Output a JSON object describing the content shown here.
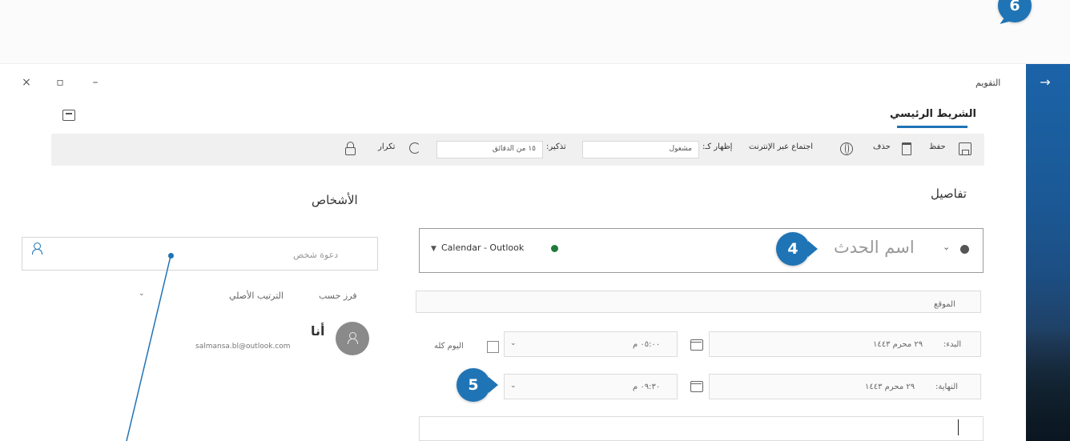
{
  "callouts": {
    "c4": "4",
    "c5": "5",
    "c6": "6"
  },
  "titlebar": {
    "app_label": "التقويم",
    "close": "×",
    "restore": "▫",
    "minimize": "–"
  },
  "ribbon": {
    "tab_home": "الشريط الرئيسي",
    "save": "حفظ",
    "delete": "حذف",
    "online_meeting": "اجتماع عبر الإنترنت",
    "show_as_label": "إظهار كـ:",
    "show_as_value": "مشغول",
    "reminder_label": "تذكير:",
    "reminder_value": "١٥ من الدقائق",
    "repeat": "تكرار"
  },
  "details": {
    "title": "تفاصيل",
    "event_name_placeholder": "اسم الحدث",
    "calendar": "Calendar - Outlook",
    "location_placeholder": "الموقع",
    "start_label": "البدء:",
    "start_date": "٢٩ محرم ١٤٤٣",
    "start_time": "٠٥:٠٠ م",
    "all_day": "اليوم كله",
    "end_label": "النهاية:",
    "end_date": "٢٩ محرم ١٤٤٣",
    "end_time": "٠٩:٣٠ م"
  },
  "people": {
    "title": "الأشخاص",
    "invite_placeholder": "دعوة شخص",
    "sort_label": "فرز حسب",
    "sort_value": "الترتيب الأصلي",
    "me_name": "أنا",
    "me_email": "salmansa.bl@outlook.com"
  },
  "colors": {
    "accent": "#1f74b5",
    "calendar_dot": "#1e7a3c"
  }
}
